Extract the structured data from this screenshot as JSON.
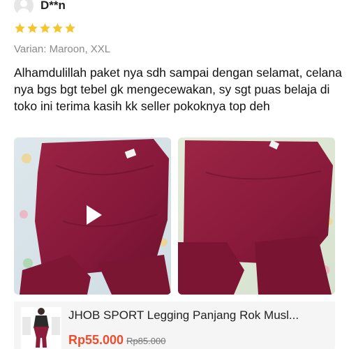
{
  "review": {
    "username": "D**n",
    "rating": 5,
    "variant": "Varian: Maroon, XXL",
    "text": "Alhamdulillah paket nya sdh sampai dengan selamat, celana nya bgs bgt tebel gk mengecewakan, sy sgt puas belaja di toko ini terima kasih kk seller pokoknya top deh"
  },
  "media": [
    {
      "type": "video",
      "icon": "play-icon"
    },
    {
      "type": "photo"
    }
  ],
  "product": {
    "title": "JHOB SPORT Legging Panjang Rok Musl...",
    "price": "Rp55.000",
    "original_price": "Rp85.000"
  },
  "colors": {
    "star": "#f6c42d",
    "price": "#ee4d2d",
    "garment": "#8c1d3a",
    "muted_text": "#8a8a8a"
  }
}
